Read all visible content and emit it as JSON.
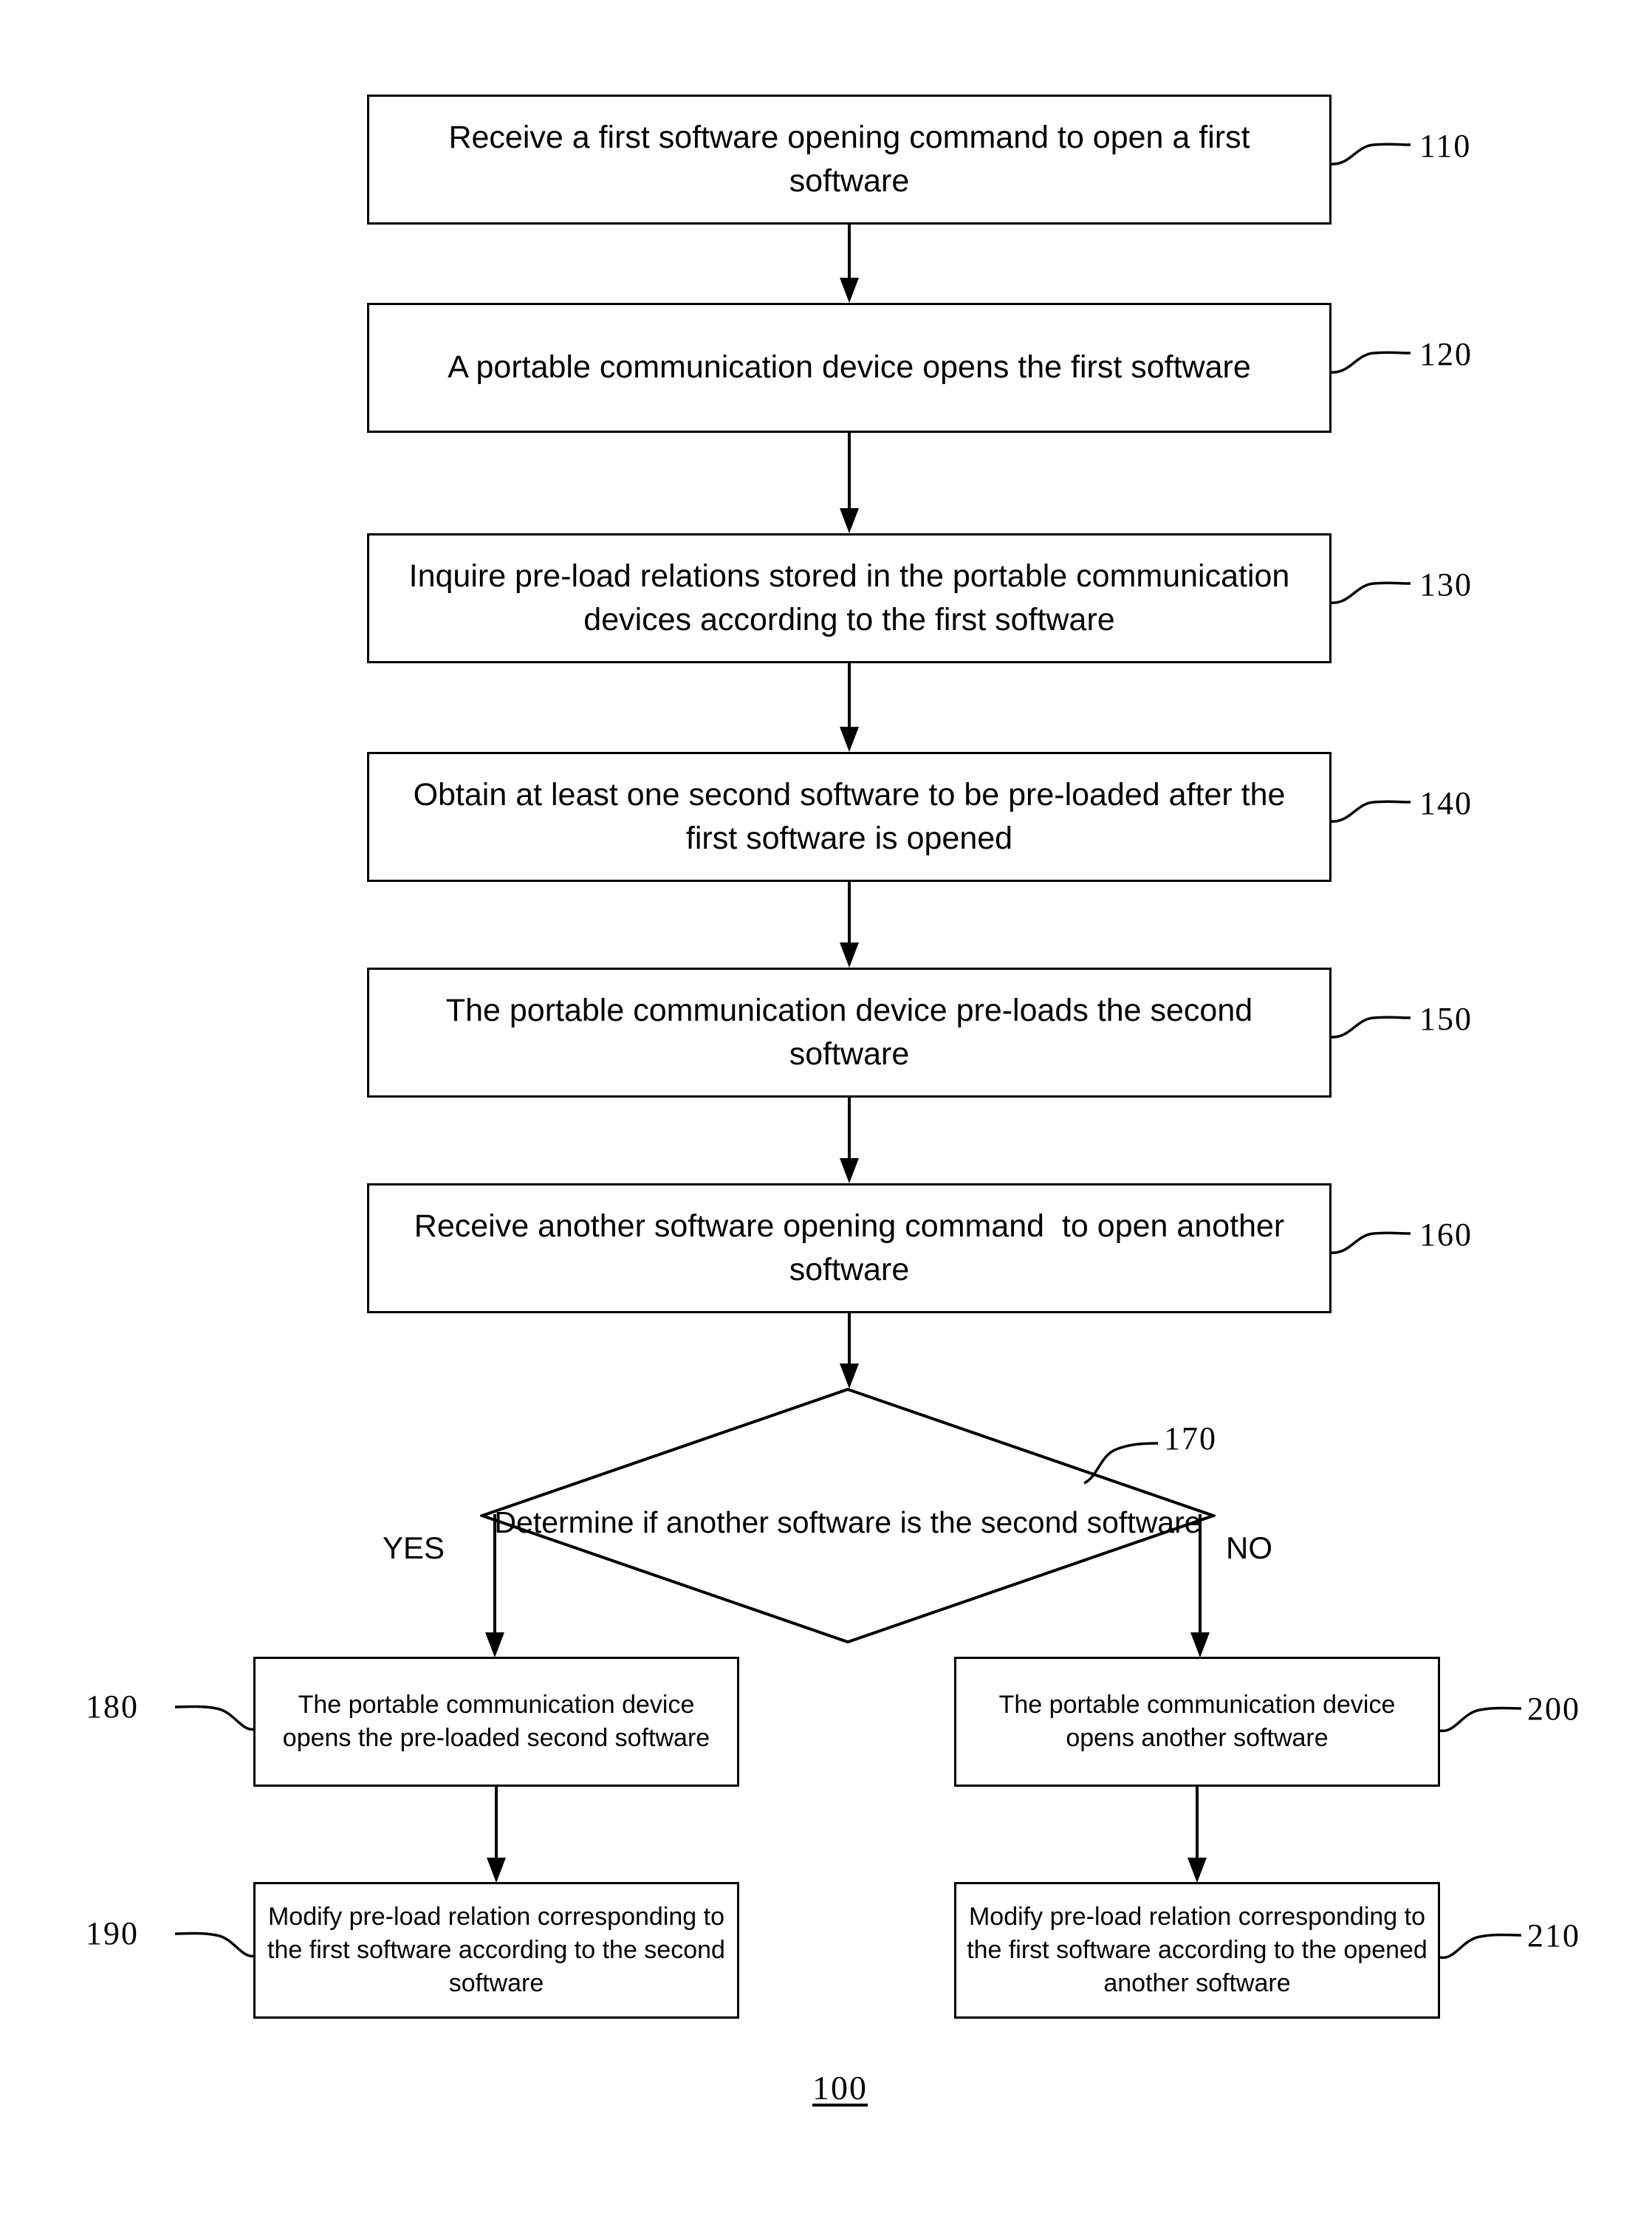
{
  "figure": {
    "number": "100",
    "type": "flowchart"
  },
  "steps": [
    {
      "id": "110",
      "ref": "110",
      "text": "Receive a first software opening command to open a first software"
    },
    {
      "id": "120",
      "ref": "120",
      "text": "A portable communication device opens the first software"
    },
    {
      "id": "130",
      "ref": "130",
      "text": "Inquire pre-load relations stored in the portable communication devices according to the first software"
    },
    {
      "id": "140",
      "ref": "140",
      "text": "Obtain at least one second software to be pre-loaded after the first software is opened"
    },
    {
      "id": "150",
      "ref": "150",
      "text": "The portable communication device pre-loads the second software"
    },
    {
      "id": "160",
      "ref": "160",
      "text": "Receive another software opening command  to open another software"
    }
  ],
  "decision": {
    "id": "170",
    "ref": "170",
    "text": "Determine\nif another software is the\nsecond\nsoftware",
    "yes_label": "YES",
    "no_label": "NO"
  },
  "branch_yes": [
    {
      "id": "180",
      "ref": "180",
      "text": "The portable communication device opens the pre-loaded second software"
    },
    {
      "id": "190",
      "ref": "190",
      "text": "Modify pre-load relation corresponding to the first software according to the second software"
    }
  ],
  "branch_no": [
    {
      "id": "200",
      "ref": "200",
      "text": "The portable communication device opens another software"
    },
    {
      "id": "210",
      "ref": "210",
      "text": "Modify pre-load relation corresponding to the first software according to the opened another software"
    }
  ],
  "colors": {
    "stroke": "#000000",
    "background": "#ffffff"
  }
}
